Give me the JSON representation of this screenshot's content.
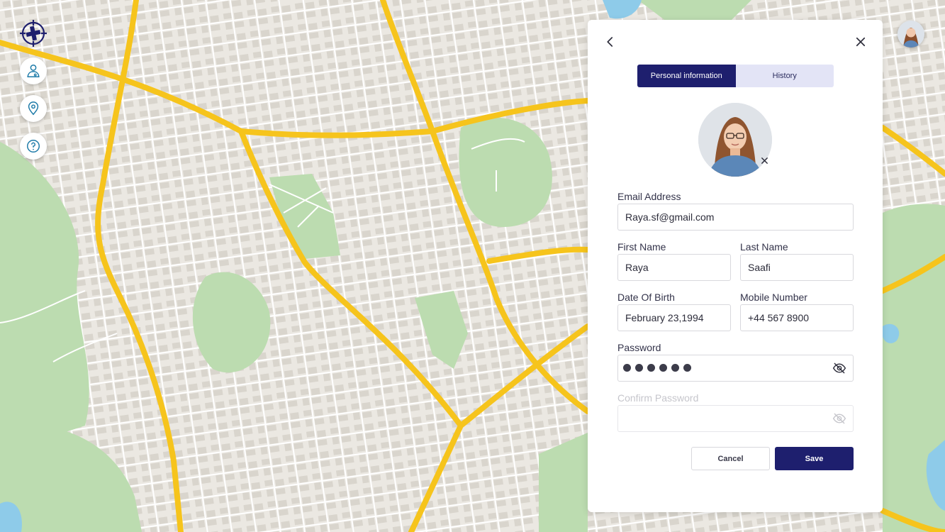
{
  "colors": {
    "primary": "#1e1f6e",
    "tab_inactive": "#e3e4f6",
    "map_road": "#f6c41c",
    "map_park": "#bcdcb0",
    "map_water": "#8ecbe9",
    "map_land": "#ebe8e2"
  },
  "sidebar": {
    "logo_icon": "crosshair-plus-logo",
    "items": [
      {
        "icon": "doctor-user-icon"
      },
      {
        "icon": "location-pin-icon"
      },
      {
        "icon": "help-circle-icon"
      }
    ]
  },
  "header": {
    "avatar_icon": "user-avatar"
  },
  "panel": {
    "back_icon": "chevron-left-icon",
    "close_icon": "close-icon",
    "tabs": [
      {
        "label": "Personal information",
        "active": true
      },
      {
        "label": "History",
        "active": false
      }
    ],
    "form": {
      "email": {
        "label": "Email Address",
        "value": "Raya.sf@gmail.com"
      },
      "first_name": {
        "label": "First Name",
        "value": "Raya"
      },
      "last_name": {
        "label": "Last Name",
        "value": "Saafi"
      },
      "dob": {
        "label": "Date Of Birth",
        "value": "February 23,1994"
      },
      "mobile": {
        "label": "Mobile Number",
        "value": "+44 567 8900"
      },
      "password": {
        "label": "Password",
        "masked_length": 6,
        "toggle_icon": "eye-off-icon"
      },
      "confirm_password": {
        "label": "Confirm Password",
        "value": "",
        "toggle_icon": "eye-off-icon"
      }
    },
    "buttons": {
      "cancel": "Cancel",
      "save": "Save"
    }
  }
}
